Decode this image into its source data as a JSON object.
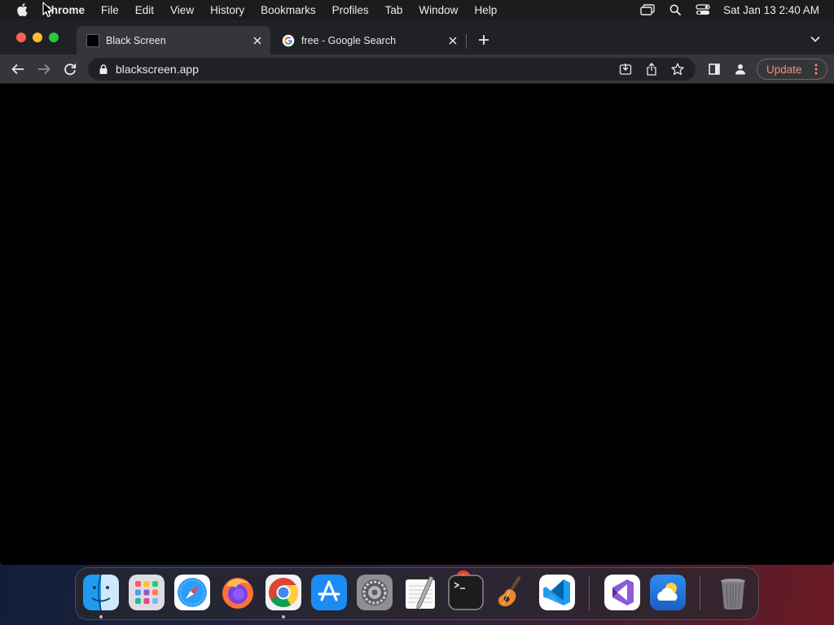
{
  "menubar": {
    "app_name": "Chrome",
    "items": [
      "File",
      "Edit",
      "View",
      "History",
      "Bookmarks",
      "Profiles",
      "Tab",
      "Window",
      "Help"
    ],
    "clock": "Sat Jan 13  2:40 AM",
    "status_icons": [
      "screen-mirroring-icon",
      "spotlight-search-icon",
      "control-center-icon"
    ]
  },
  "browser": {
    "tabs": [
      {
        "title": "Black Screen",
        "favicon": "black-square-icon",
        "active": true
      },
      {
        "title": "free - Google Search",
        "favicon": "google-g-icon",
        "active": false
      }
    ],
    "url": "blackscreen.app",
    "update_label": "Update"
  },
  "dock": {
    "apps": [
      "Finder",
      "Launchpad",
      "Safari",
      "Firefox",
      "Google Chrome",
      "App Store",
      "System Settings",
      "TextEdit",
      "Terminal",
      "GarageBand",
      "Visual Studio Code",
      "Visual Studio",
      "Weather",
      "Trash"
    ],
    "settings_badge": "1"
  },
  "colors": {
    "menubar": "#1c1c1e",
    "tabstrip": "#202124",
    "toolbar": "#35363a",
    "content": "#000000",
    "update_text": "#f28b82"
  }
}
